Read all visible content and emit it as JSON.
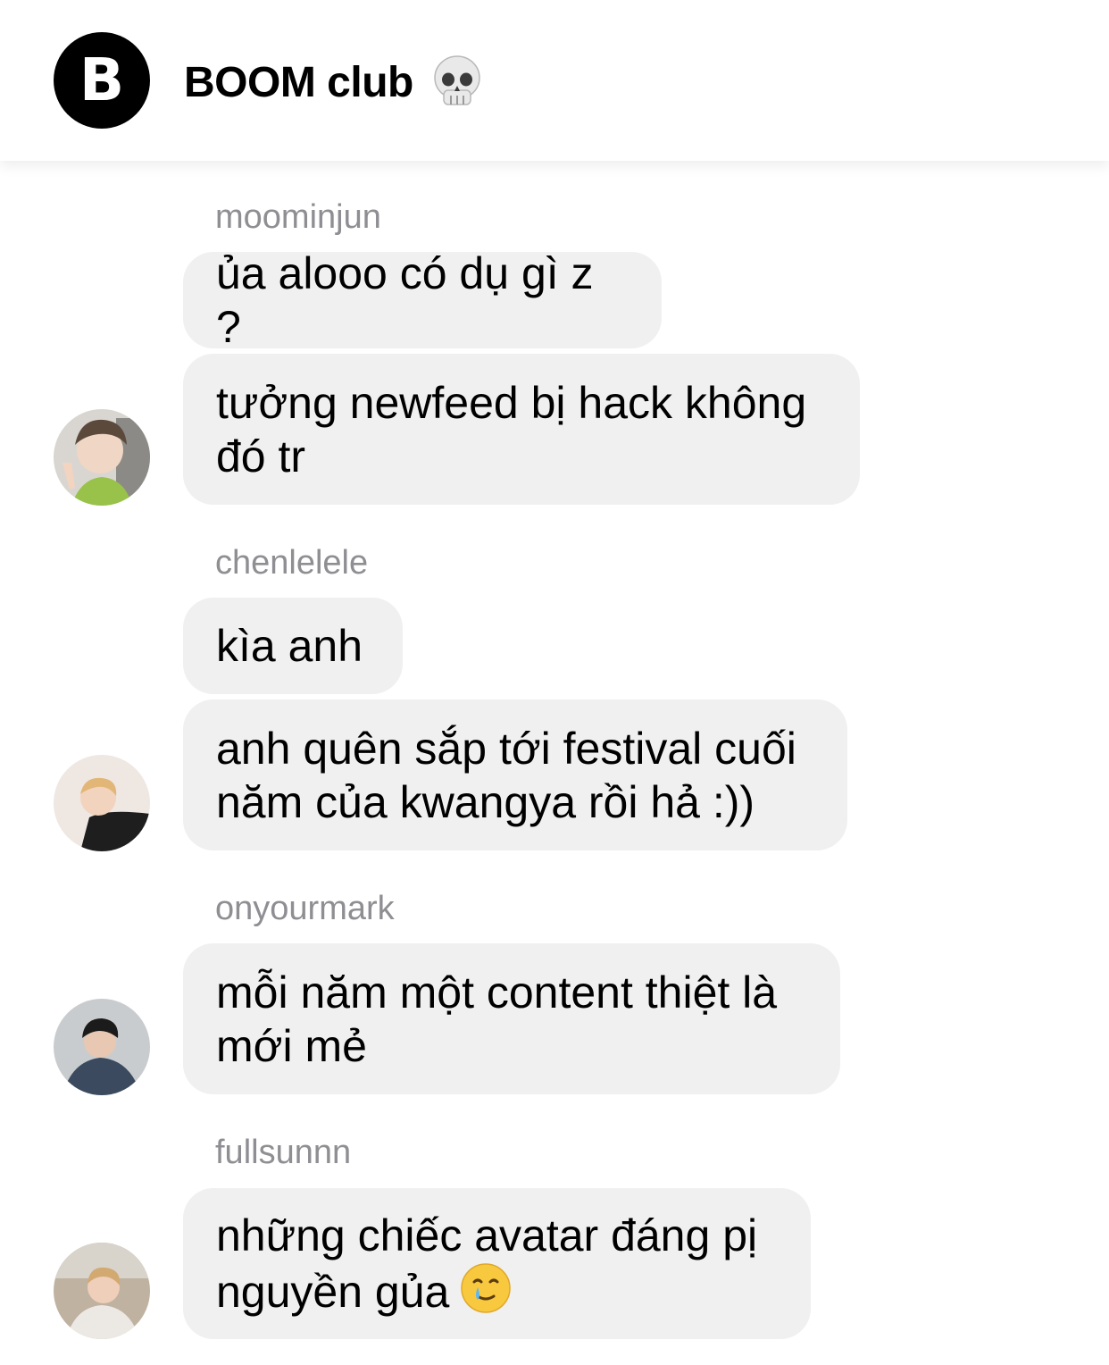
{
  "header": {
    "avatar_letter": "B",
    "title": "BOOM club",
    "title_emoji": "skull-icon"
  },
  "messages": [
    {
      "sender": "moominjun",
      "bubbles": [
        "ủa alooo có dụ gì z ?",
        "tưởng newfeed bị hack không đó tr"
      ]
    },
    {
      "sender": "chenlelele",
      "bubbles": [
        "kìa anh",
        "anh quên sắp tới festival cuối năm của kwangya rồi hả :))"
      ]
    },
    {
      "sender": "onyourmark",
      "bubbles": [
        "mỗi năm một content thiệt là mới mẻ"
      ]
    },
    {
      "sender": "fullsunnn",
      "bubbles": [
        "những chiếc avatar đáng pị nguyền gủa"
      ],
      "trailing_emoji": "crying-smile-emoji"
    }
  ],
  "colors": {
    "bubble_bg": "#f0f0f0",
    "sender_text": "#8e8e93",
    "header_avatar_bg": "#000000"
  }
}
